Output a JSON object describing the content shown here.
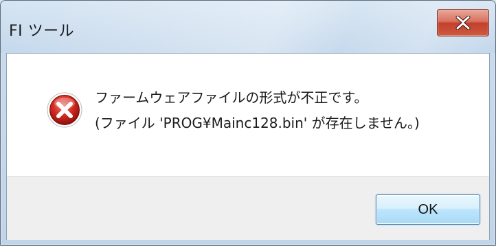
{
  "window": {
    "title": "FI ツール",
    "close_icon": "close-x-icon"
  },
  "message": {
    "icon": "error-icon",
    "line1": "ファームウェアファイルの形式が不正です。",
    "line2": "(ファイル 'PROG¥Mainc128.bin' が存在しません。)"
  },
  "buttons": {
    "ok_label": "OK"
  },
  "colors": {
    "close_button": "#c2402d",
    "error_icon": "#c0201b",
    "ok_border": "#3c7fb1",
    "footer_bg": "#efefef"
  }
}
